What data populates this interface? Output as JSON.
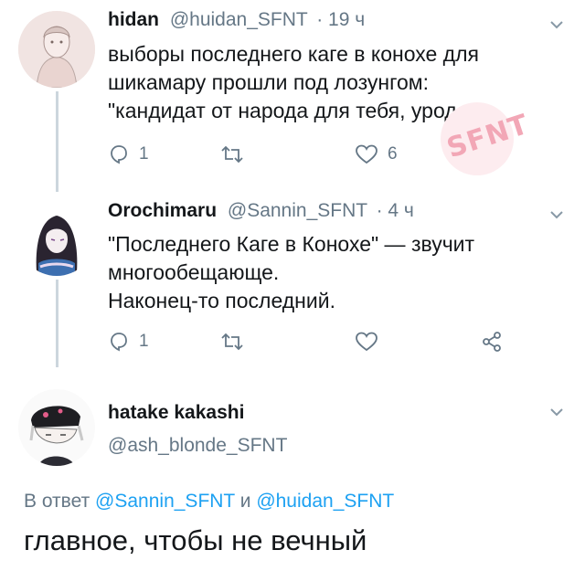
{
  "tweets": [
    {
      "name": "hidan",
      "handle": "@huidan_SFNT",
      "time": "· 19 ч",
      "lines": [
        "выборы последнего каге в конохе для",
        "шикамару прошли под лозунгом:",
        "\"кандидат от народа для тебя, урода\""
      ],
      "replies": "1",
      "retweets": "",
      "likes": "6"
    },
    {
      "name": "Orochimaru",
      "handle": "@Sannin_SFNT",
      "time": "· 4 ч",
      "lines": [
        "\"Последнего Каге в Конохе\" — звучит",
        "многообещающе.",
        "Наконец-то последний."
      ],
      "replies": "1",
      "retweets": "",
      "likes": ""
    }
  ],
  "reply": {
    "name": "hatake kakashi",
    "handle": "@ash_blonde_SFNT",
    "in_reply_prefix": "В ответ",
    "mention1": "@Sannin_SFNT",
    "conj": "и",
    "mention2": "@huidan_SFNT",
    "text": "главное, чтобы не вечный"
  },
  "watermark": "SFNT",
  "colors": {
    "link": "#1da1f2",
    "secondary": "#657786",
    "thread_line": "#ccd6dd",
    "watermark": "#f2a7b6"
  },
  "icons": [
    "reply-icon",
    "retweet-icon",
    "like-icon",
    "share-icon",
    "chevron-down-icon"
  ]
}
